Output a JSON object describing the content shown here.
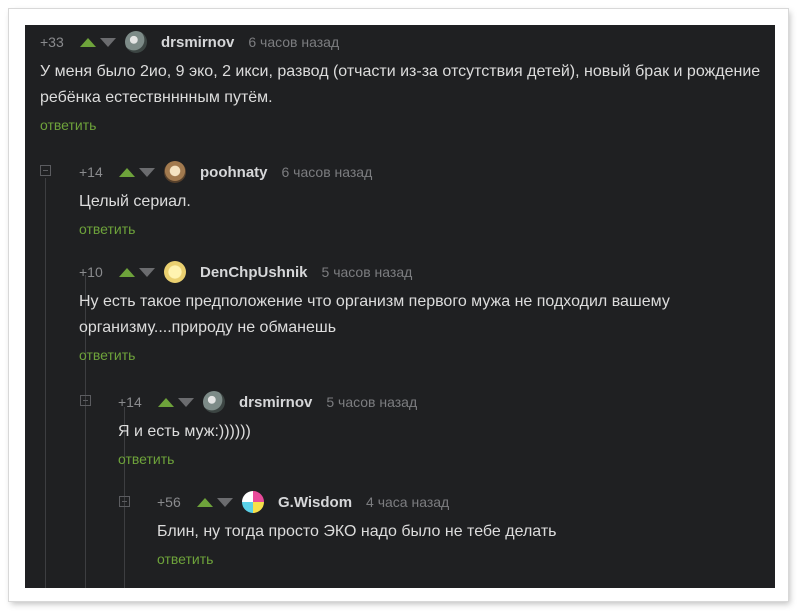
{
  "comments": [
    {
      "rating": "+33",
      "username": "drsmirnov",
      "time": "6 часов назад",
      "text": "У меня было 2ио, 9 эко, 2 икси, развод (отчасти из-за отсутствия детей), новый брак и рождение ребёнка естествнннным путём.",
      "reply": "ответить",
      "avatar": "globe-avatar"
    },
    {
      "rating": "+14",
      "username": "poohnaty",
      "time": "6 часов назад",
      "text": "Целый сериал.",
      "reply": "ответить",
      "avatar": "dog-avatar"
    },
    {
      "rating": "+10",
      "username": "DenChpUshnik",
      "time": "5 часов назад",
      "text": "Ну есть такое предположение что организм первого мужа не подходил вашему организму....природу не обманешь",
      "reply": "ответить",
      "avatar": "smile-avatar"
    },
    {
      "rating": "+14",
      "username": "drsmirnov",
      "time": "5 часов назад",
      "text": "Я и есть муж:))))))",
      "reply": "ответить",
      "avatar": "globe-avatar"
    },
    {
      "rating": "+56",
      "username": "G.Wisdom",
      "time": "4 часа назад",
      "text": "Блин, ну тогда просто ЭКО надо было не тебе делать",
      "reply": "ответить",
      "avatar": "flower-avatar"
    }
  ],
  "colors": {
    "background": "#1f2022",
    "accent_green": "#6ea33b",
    "text": "#dcdcdc",
    "muted": "#7c7d80"
  }
}
